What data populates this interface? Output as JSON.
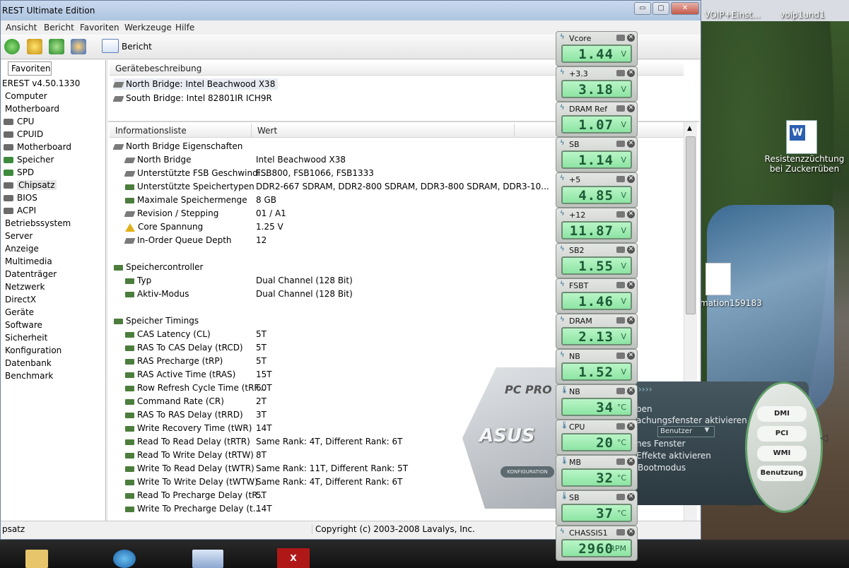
{
  "window": {
    "title": "REST Ultimate Edition",
    "controls": {
      "minimize": "▭",
      "maximize": "▢",
      "close": "✕"
    }
  },
  "menu": [
    "Ansicht",
    "Bericht",
    "Favoriten",
    "Werkzeuge",
    "Hilfe"
  ],
  "toolbar": {
    "report_label": "Bericht"
  },
  "sidebar": {
    "tab": "Favoriten",
    "items": [
      {
        "label": "EREST v4.50.1330",
        "indent": 0
      },
      {
        "label": "Computer",
        "indent": 1
      },
      {
        "label": "Motherboard",
        "indent": 1
      },
      {
        "label": "CPU",
        "indent": 2
      },
      {
        "label": "CPUID",
        "indent": 2
      },
      {
        "label": "Motherboard",
        "indent": 2
      },
      {
        "label": "Speicher",
        "indent": 2
      },
      {
        "label": "SPD",
        "indent": 2
      },
      {
        "label": "Chipsatz",
        "indent": 2
      },
      {
        "label": "BIOS",
        "indent": 2
      },
      {
        "label": "ACPI",
        "indent": 2
      },
      {
        "label": "Betriebssystem",
        "indent": 1
      },
      {
        "label": "Server",
        "indent": 1
      },
      {
        "label": "Anzeige",
        "indent": 1
      },
      {
        "label": "Multimedia",
        "indent": 1
      },
      {
        "label": "Datenträger",
        "indent": 1
      },
      {
        "label": "Netzwerk",
        "indent": 1
      },
      {
        "label": "DirectX",
        "indent": 1
      },
      {
        "label": "Geräte",
        "indent": 1
      },
      {
        "label": "Software",
        "indent": 1
      },
      {
        "label": "Sicherheit",
        "indent": 1
      },
      {
        "label": "Konfiguration",
        "indent": 1
      },
      {
        "label": "Datenbank",
        "indent": 1
      },
      {
        "label": "Benchmark",
        "indent": 1
      }
    ]
  },
  "devices": {
    "header": "Gerätebeschreibung",
    "items": [
      "North Bridge: Intel Beachwood X38",
      "South Bridge: Intel 82801IR ICH9R"
    ]
  },
  "info": {
    "col1": "Informationsliste",
    "col2": "Wert",
    "rows": [
      {
        "type": "group",
        "label": "North Bridge Eigenschaften",
        "icon": "chip"
      },
      {
        "type": "item",
        "label": "North Bridge",
        "value": "Intel Beachwood X38",
        "icon": "chip"
      },
      {
        "type": "item",
        "label": "Unterstützte FSB Geschwindi...",
        "value": "FSB800, FSB1066, FSB1333",
        "icon": "chip"
      },
      {
        "type": "item",
        "label": "Unterstützte Speichertypen",
        "value": "DDR2-667 SDRAM, DDR2-800 SDRAM, DDR3-800 SDRAM, DDR3-10...",
        "icon": "mem"
      },
      {
        "type": "item",
        "label": "Maximale Speichermenge",
        "value": "8 GB",
        "icon": "mem"
      },
      {
        "type": "item",
        "label": "Revision / Stepping",
        "value": "01 / A1",
        "icon": "chip"
      },
      {
        "type": "item",
        "label": "Core Spannung",
        "value": "1.25 V",
        "icon": "warn"
      },
      {
        "type": "item",
        "label": "In-Order Queue Depth",
        "value": "12",
        "icon": "chip"
      },
      {
        "type": "gap"
      },
      {
        "type": "group",
        "label": "Speichercontroller",
        "icon": "mem"
      },
      {
        "type": "item",
        "label": "Typ",
        "value": "Dual Channel  (128 Bit)",
        "icon": "mem"
      },
      {
        "type": "item",
        "label": "Aktiv-Modus",
        "value": "Dual Channel  (128 Bit)",
        "icon": "mem"
      },
      {
        "type": "gap"
      },
      {
        "type": "group",
        "label": "Speicher Timings",
        "icon": "mem"
      },
      {
        "type": "item",
        "label": "CAS Latency (CL)",
        "value": "5T",
        "icon": "mem"
      },
      {
        "type": "item",
        "label": "RAS To CAS Delay (tRCD)",
        "value": "5T",
        "icon": "mem"
      },
      {
        "type": "item",
        "label": "RAS Precharge (tRP)",
        "value": "5T",
        "icon": "mem"
      },
      {
        "type": "item",
        "label": "RAS Active Time (tRAS)",
        "value": "15T",
        "icon": "mem"
      },
      {
        "type": "item",
        "label": "Row Refresh Cycle Time (tRF...",
        "value": "60T",
        "icon": "mem"
      },
      {
        "type": "item",
        "label": "Command Rate (CR)",
        "value": "2T",
        "icon": "mem"
      },
      {
        "type": "item",
        "label": "RAS To RAS Delay (tRRD)",
        "value": "3T",
        "icon": "mem"
      },
      {
        "type": "item",
        "label": "Write Recovery Time (tWR)",
        "value": "14T",
        "icon": "mem"
      },
      {
        "type": "item",
        "label": "Read To Read Delay (tRTR)",
        "value": "Same Rank: 4T, Different Rank: 6T",
        "icon": "mem"
      },
      {
        "type": "item",
        "label": "Read To Write Delay (tRTW)",
        "value": "8T",
        "icon": "mem"
      },
      {
        "type": "item",
        "label": "Write To Read Delay (tWTR)",
        "value": "Same Rank: 11T, Different Rank: 5T",
        "icon": "mem"
      },
      {
        "type": "item",
        "label": "Write To Write Delay (tWTW)",
        "value": "Same Rank: 4T, Different Rank: 6T",
        "icon": "mem"
      },
      {
        "type": "item",
        "label": "Read To Precharge Delay (tR...",
        "value": "5T",
        "icon": "mem"
      },
      {
        "type": "item",
        "label": "Write To Precharge Delay (t...",
        "value": "14T",
        "icon": "mem"
      }
    ]
  },
  "status": {
    "left": "psatz",
    "center": "Copyright (c) 2003-2008 Lavalys, Inc."
  },
  "sensors": [
    {
      "name": "Vcore",
      "value": "1.44",
      "unit": "V"
    },
    {
      "name": "+3.3",
      "value": "3.18",
      "unit": "V"
    },
    {
      "name": "DRAM Ref",
      "value": "1.07",
      "unit": "V"
    },
    {
      "name": "SB",
      "value": "1.14",
      "unit": "V"
    },
    {
      "name": "+5",
      "value": "4.85",
      "unit": "V"
    },
    {
      "name": "+12",
      "value": "11.87",
      "unit": "V"
    },
    {
      "name": "SB2",
      "value": "1.55",
      "unit": "V"
    },
    {
      "name": "FSBT",
      "value": "1.46",
      "unit": "V"
    },
    {
      "name": "DRAM",
      "value": "2.13",
      "unit": "V"
    },
    {
      "name": "NB",
      "value": "1.52",
      "unit": "V"
    },
    {
      "name": "NB",
      "value": "34",
      "unit": "°C"
    },
    {
      "name": "CPU",
      "value": "20",
      "unit": "°C"
    },
    {
      "name": "MB",
      "value": "32",
      "unit": "°C"
    },
    {
      "name": "SB",
      "value": "37",
      "unit": "°C"
    },
    {
      "name": "CHASSIS1",
      "value": "2960",
      "unit": "RPM"
    }
  ],
  "probe": {
    "brand": "PC PRO",
    "logo": "ASUS",
    "konfig": "KONFIGURATION",
    "header": "nz",
    "lines": [
      "ben",
      "achungsfenster aktivieren",
      "nes Fenster",
      "Effekte aktivieren",
      "Bootmodus"
    ],
    "select_value": "Benutzer",
    "buttons": [
      "DMI",
      "PCI",
      "WMI",
      "Benutzung"
    ]
  },
  "desktop": {
    "top_icons": [
      "VOIP+Einst...",
      "voip1und1"
    ],
    "doc_label": "Resistenzzüchtung bei Zuckerrüben",
    "file_label": "mation159183"
  }
}
